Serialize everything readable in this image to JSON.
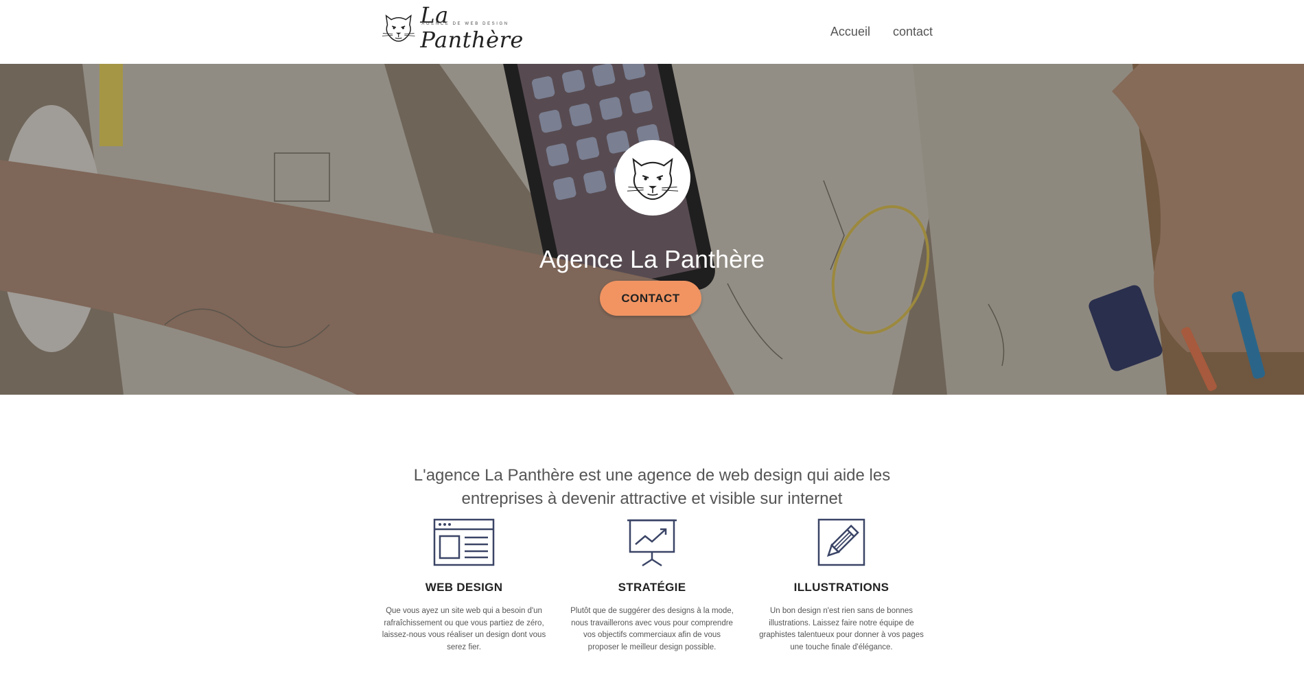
{
  "header": {
    "brand": "La Panthère",
    "tagline": "AGENCE DE WEB DESIGN",
    "logo_icon": "panther-head-icon",
    "nav": [
      {
        "label": "Accueil"
      },
      {
        "label": "contact"
      }
    ]
  },
  "hero": {
    "badge_icon": "panther-head-icon",
    "title": "Agence La Panthère",
    "cta_label": "CONTACT",
    "cta_color": "#f19462"
  },
  "intro": {
    "text": "L'agence La Panthère est une agence de web design qui aide les entreprises à devenir attractive et visible sur internet"
  },
  "services": [
    {
      "icon": "browser-window-icon",
      "title": "WEB DESIGN",
      "text": "Que vous ayez un site web qui a besoin d'un rafraîchissement ou que vous partiez de zéro, laissez-nous vous réaliser un design dont vous serez fier."
    },
    {
      "icon": "presentation-chart-icon",
      "title": "STRATÉGIE",
      "text": "Plutôt que de suggérer des designs à la mode, nous travaillerons avec vous pour comprendre vos objectifs commerciaux afin de vous proposer le meilleur design possible."
    },
    {
      "icon": "pencil-icon",
      "title": "ILLUSTRATIONS",
      "text": "Un bon design n'est rien sans de bonnes illustrations. Laissez faire notre équipe de graphistes talentueux pour donner à vos pages une touche finale d'élégance."
    }
  ],
  "colors": {
    "icon_stroke": "#3a4466",
    "accent": "#f19462"
  }
}
